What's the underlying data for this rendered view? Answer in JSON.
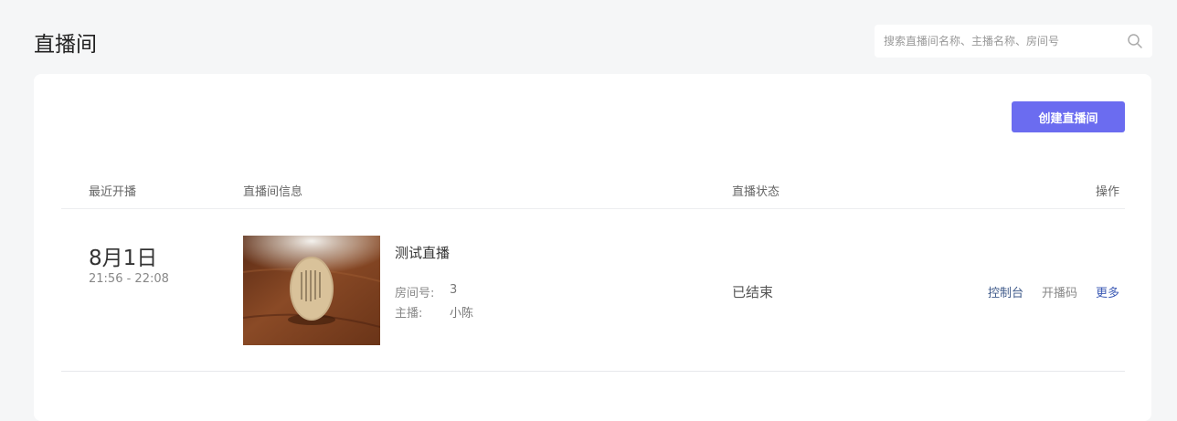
{
  "header": {
    "title": "直播间",
    "search_placeholder": "搜索直播间名称、主播名称、房间号",
    "search_value": ""
  },
  "toolbar": {
    "create_label": "创建直播间"
  },
  "table": {
    "columns": [
      "最近开播",
      "直播间信息",
      "直播状态",
      "操作"
    ],
    "rows": [
      {
        "date": "8月1日",
        "time_range": "21:56 - 22:08",
        "thumbnail": "tea-cup-thumbnail",
        "name": "测试直播",
        "room_label": "房间号:",
        "room_value": "3",
        "host_label": "主播:",
        "host_value": "小陈",
        "status": "已结束",
        "actions": [
          "控制台",
          "开播码",
          "更多"
        ]
      }
    ]
  },
  "colors": {
    "accent": "#6b6cf0",
    "background": "#f5f6f7",
    "card": "#ffffff",
    "link": "#3d5bb5"
  }
}
